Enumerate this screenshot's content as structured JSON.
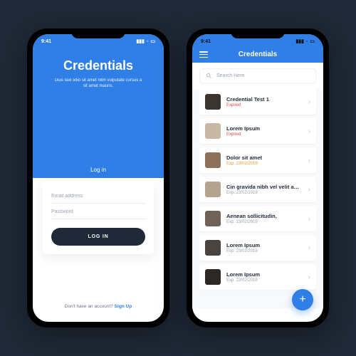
{
  "status": {
    "time": "9:41"
  },
  "login": {
    "title": "Credentials",
    "subtitle": "Duis sed odio sit amet nibh vulputate cursus a sit amet mauris.",
    "tab": "Log in",
    "email_placeholder": "Email address",
    "password_placeholder": "Password",
    "button": "LOG IN",
    "signup_prompt": "Don't have an account? ",
    "signup_link": "Sign Up"
  },
  "list": {
    "header": "Credentials",
    "search_placeholder": "Search Here",
    "fab": "+",
    "items": [
      {
        "title": "Credential Test 1",
        "sub": "Expired",
        "subClass": "sub-red",
        "thumb": "#3a3530"
      },
      {
        "title": "Lorem Ipsum",
        "sub": "Expired",
        "subClass": "sub-red",
        "thumb": "#c7b9a6"
      },
      {
        "title": "Dolor sit amet",
        "sub": "Exp. 23/02/2019",
        "subClass": "sub-orange",
        "thumb": "#8d715a"
      },
      {
        "title": "Cin gravida nibh vel velit auctor",
        "sub": "Exp. 23/02/2019",
        "subClass": "sub-gray",
        "thumb": "#b3a38f"
      },
      {
        "title": "Aenean sollicitudin,",
        "sub": "Exp. 23/02/2019",
        "subClass": "sub-gray",
        "thumb": "#6f6358"
      },
      {
        "title": "Lorem Ipsum",
        "sub": "Exp. 23/02/2019",
        "subClass": "sub-gray",
        "thumb": "#4a4440"
      },
      {
        "title": "Lorem Ipsum",
        "sub": "Exp. 23/02/2019",
        "subClass": "sub-gray",
        "thumb": "#2b2826"
      }
    ]
  }
}
